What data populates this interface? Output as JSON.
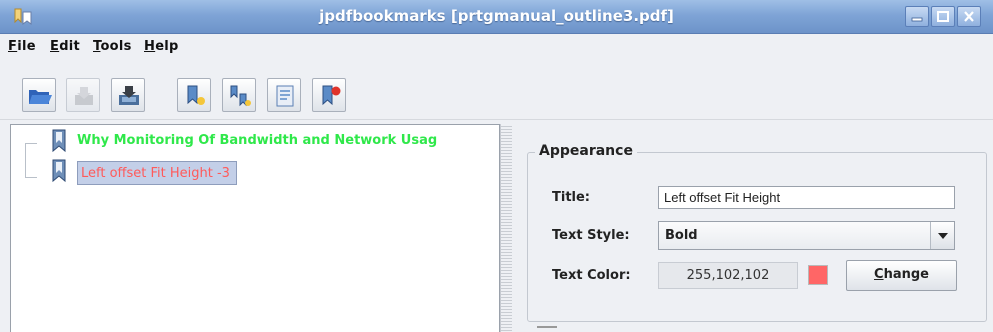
{
  "window": {
    "title": "jpdfbookmarks [prtgmanual_outline3.pdf]",
    "icon": "app-logo-icon",
    "controls": [
      "minimize-icon",
      "maximize-icon",
      "close-icon"
    ]
  },
  "menu": [
    {
      "mnemonic": "F",
      "rest": "ile"
    },
    {
      "mnemonic": "E",
      "rest": "dit"
    },
    {
      "mnemonic": "T",
      "rest": "ools"
    },
    {
      "mnemonic": "H",
      "rest": "elp"
    }
  ],
  "toolbar": {
    "buttons": [
      "open-file-icon",
      "save-icon",
      "save-as-icon",
      "add-bookmark-icon",
      "add-child-bookmark-icon",
      "edit-bookmark-icon",
      "delete-bookmark-icon"
    ]
  },
  "tree": {
    "nodes": [
      {
        "label": "Why Monitoring Of Bandwidth and Network Usag",
        "color": "#2fe84a",
        "bold": true,
        "selected": false
      },
      {
        "label": "Left offset Fit Height -3",
        "color": "#ff5a5a",
        "bold": false,
        "selected": true
      }
    ]
  },
  "appearance": {
    "group_title": "Appearance",
    "title_label": "Title:",
    "title_value": "Left offset Fit Height",
    "style_label": "Text Style:",
    "style_value": "Bold",
    "color_label": "Text Color:",
    "color_value": "255,102,102",
    "swatch_color": "#ff6666",
    "change_mnemonic": "C",
    "change_rest": "hange"
  }
}
